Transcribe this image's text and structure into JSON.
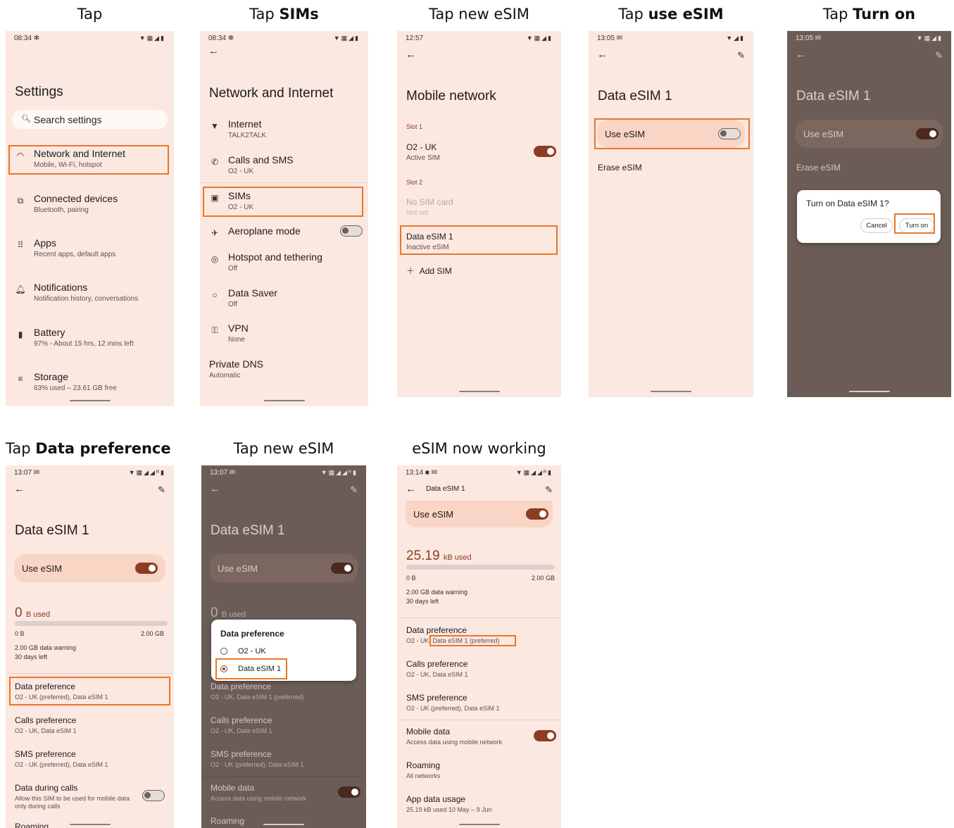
{
  "captions": {
    "c1": "Tap",
    "c2_pre": "Tap ",
    "c2_bold": "SIMs",
    "c3": "Tap new eSIM",
    "c4_pre": "Tap ",
    "c4_bold": "use eSIM",
    "c5_pre": "Tap ",
    "c5_bold": "Turn on",
    "c6_pre": "Tap ",
    "c6_bold": "Data preference",
    "c7": "Tap new eSIM",
    "c8": "eSIM now working"
  },
  "s1": {
    "time": "08:34 ✻",
    "title": "Settings",
    "search_placeholder": "Search settings",
    "items": [
      {
        "title": "Network and Internet",
        "sub": "Mobile, Wi-Fi, hotspot"
      },
      {
        "title": "Connected devices",
        "sub": "Bluetooth, pairing"
      },
      {
        "title": "Apps",
        "sub": "Recent apps, default apps"
      },
      {
        "title": "Notifications",
        "sub": "Notification history, conversations"
      },
      {
        "title": "Battery",
        "sub": "97% - About 15 hrs, 12 mins left"
      },
      {
        "title": "Storage",
        "sub": "63% used – 23.61 GB free"
      }
    ]
  },
  "s2": {
    "time": "08:34 ✻",
    "title": "Network and Internet",
    "items": [
      {
        "title": "Internet",
        "sub": "TALK2TALK"
      },
      {
        "title": "Calls and SMS",
        "sub": "O2 - UK"
      },
      {
        "title": "SIMs",
        "sub": "O2 - UK"
      },
      {
        "title": "Aeroplane mode",
        "sub": ""
      },
      {
        "title": "Hotspot and tethering",
        "sub": "Off"
      },
      {
        "title": "Data Saver",
        "sub": "Off"
      },
      {
        "title": "VPN",
        "sub": "None"
      },
      {
        "title": "Private DNS",
        "sub": "Automatic"
      }
    ]
  },
  "s3": {
    "time": "12:57",
    "title": "Mobile network",
    "slot1": "Slot 1",
    "sim1_title": "O2 - UK",
    "sim1_sub": "Active SIM",
    "slot2": "Slot 2",
    "nosim_title": "No SIM card",
    "nosim_sub": "Not set",
    "esim_title": "Data eSIM 1",
    "esim_sub": "Inactive eSIM",
    "add_sim": "Add SIM"
  },
  "s4": {
    "time": "13:05 ✉",
    "title": "Data eSIM 1",
    "use_esim": "Use eSIM",
    "erase": "Erase eSIM"
  },
  "s5": {
    "time": "13:05 ✉",
    "title": "Data eSIM 1",
    "use_esim": "Use eSIM",
    "erase": "Erase eSIM",
    "dialog_title": "Turn on Data eSIM 1?",
    "cancel": "Cancel",
    "turn_on": "Turn on"
  },
  "s6": {
    "time": "13:07 ✉",
    "title": "Data eSIM 1",
    "use_esim": "Use eSIM",
    "used_num": "0",
    "used_unit": "B used",
    "usage_fraction": 0,
    "left_label": "0 B",
    "right_label": "2.00 GB",
    "warning": "2.00 GB data warning",
    "days_left": "30 days left",
    "items": [
      {
        "title": "Data preference",
        "sub": "O2 - UK (preferred), Data eSIM 1"
      },
      {
        "title": "Calls preference",
        "sub": "O2 - UK, Data eSIM 1"
      },
      {
        "title": "SMS preference",
        "sub": "O2 - UK (preferred), Data eSIM 1"
      },
      {
        "title": "Data during calls",
        "sub": "Allow this SIM to be used for mobile data only during calls"
      },
      {
        "title": "Roaming",
        "sub": ""
      }
    ]
  },
  "s7": {
    "time": "13:07 ✉",
    "title": "Data eSIM 1",
    "use_esim": "Use eSIM",
    "used_num": "0",
    "used_unit": "B used",
    "dialog_title": "Data preference",
    "opt1": "O2 - UK",
    "opt2": "Data eSIM 1",
    "items": [
      {
        "title": "Data preference",
        "sub": "O2 - UK, Data eSIM 1 (preferred)"
      },
      {
        "title": "Calls preference",
        "sub": "O2 - UK, Data eSIM 1"
      },
      {
        "title": "SMS preference",
        "sub": "O2 - UK (preferred), Data eSIM 1"
      },
      {
        "title": "Mobile data",
        "sub": "Access data using mobile network"
      },
      {
        "title": "Roaming",
        "sub": ""
      }
    ]
  },
  "s8": {
    "time": "13:14 ■ ✉",
    "header": "Data eSIM 1",
    "use_esim": "Use eSIM",
    "used_num": "25.19",
    "used_unit": "kB used",
    "usage_fraction": 0.0,
    "left_label": "0 B",
    "right_label": "2.00 GB",
    "warning": "2.00 GB data warning",
    "days_left": "30 days left",
    "pref_title": "Data preference",
    "pref_sub_a": "O2 - UK,",
    "pref_sub_b": "Data eSIM 1 (preferred)",
    "items": [
      {
        "title": "Calls preference",
        "sub": "O2 - UK, Data eSIM 1"
      },
      {
        "title": "SMS preference",
        "sub": "O2 - UK (preferred), Data eSIM 1"
      },
      {
        "title": "Mobile data",
        "sub": "Access data using mobile network"
      },
      {
        "title": "Roaming",
        "sub": "All networks"
      },
      {
        "title": "App data usage",
        "sub": "25.19 kB used 10 May – 9 Jun"
      }
    ]
  },
  "colors": {
    "accent": "#e8762a",
    "brand": "#8a3d22",
    "bg": "#fbe8e1"
  }
}
